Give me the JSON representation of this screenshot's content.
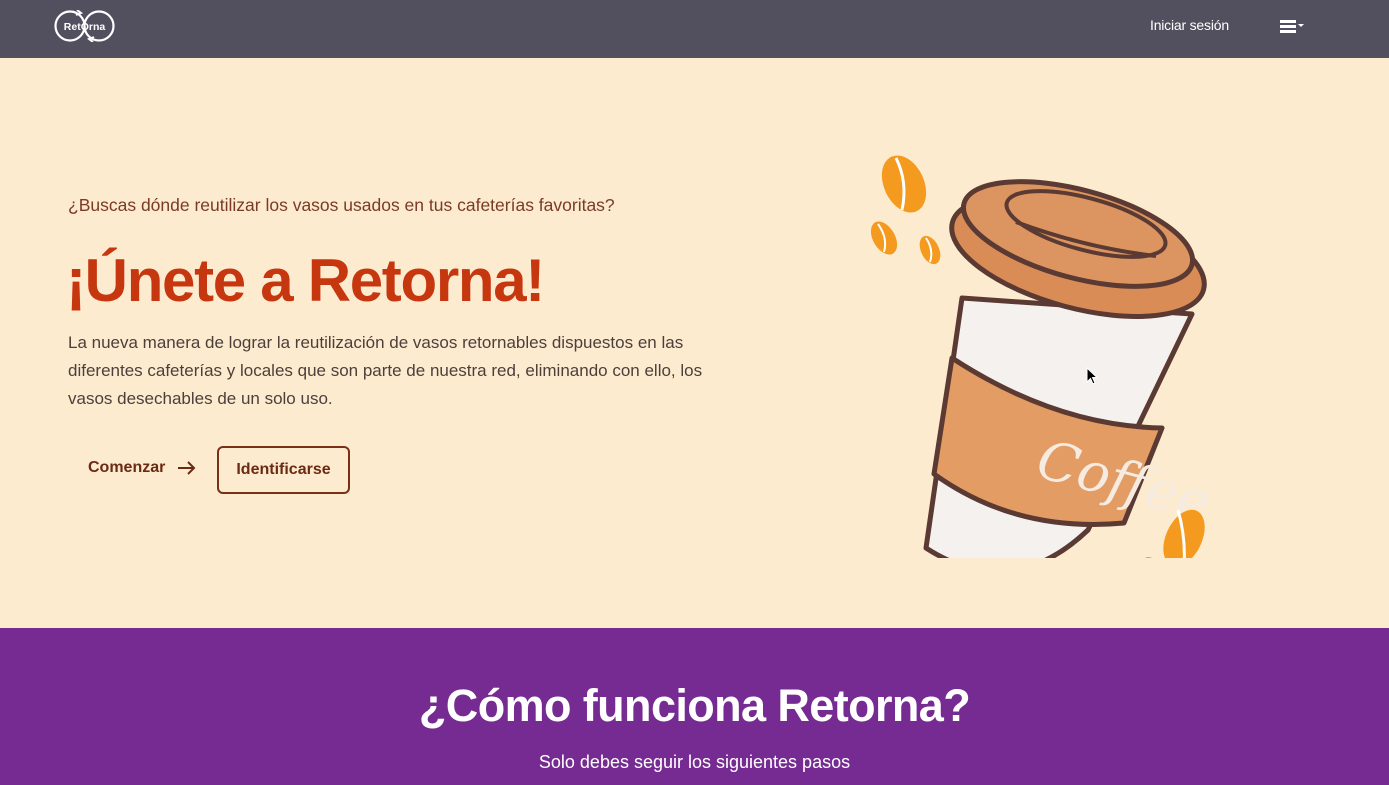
{
  "nav": {
    "logo_text": "RetOrna",
    "login_label": "Iniciar sesión",
    "menu_icon": "hamburger-menu-icon"
  },
  "hero": {
    "subtitle": "¿Buscas dónde reutilizar los vasos usados en tus cafeterías favoritas?",
    "title": "¡Únete a Retorna!",
    "description": "La nueva manera de lograr la reutilización de vasos retornables dispuestos en las diferentes cafeterías y locales que son parte de nuestra red, eliminando con ello, los vasos desechables de un solo uso.",
    "start_label": "Comenzar",
    "identify_label": "Identificarse",
    "cup_text": "Coffee"
  },
  "how": {
    "title": "¿Cómo funciona Retorna?",
    "subtitle": "Solo debes seguir los siguientes pasos"
  },
  "colors": {
    "navbar": "#52505f",
    "hero_bg": "#fdebd0",
    "title": "#c7370f",
    "accent_brown": "#7a2f17",
    "section_purple": "#762b92"
  }
}
